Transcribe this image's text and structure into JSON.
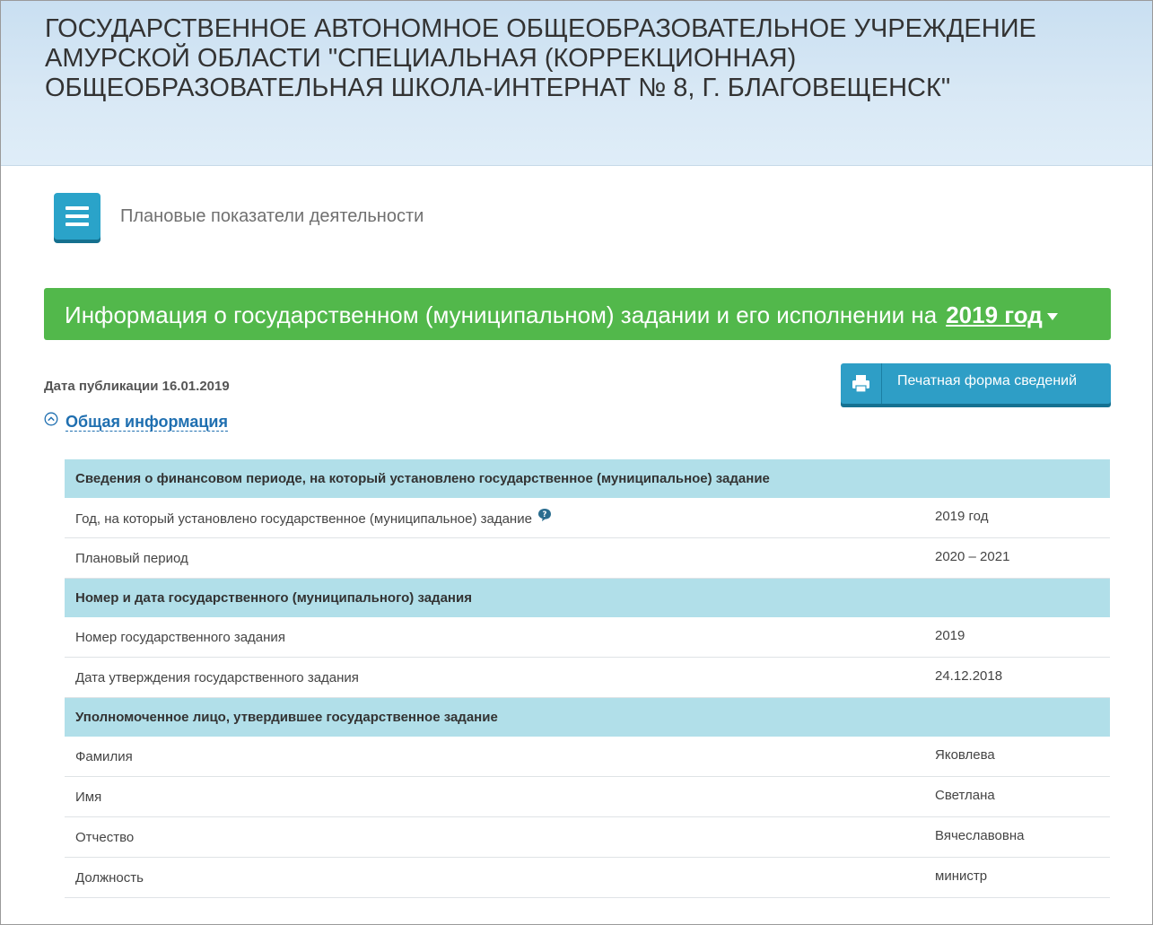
{
  "header": {
    "org_title": "ГОСУДАРСТВЕННОЕ АВТОНОМНОЕ ОБЩЕОБРАЗОВАТЕЛЬНОЕ УЧРЕЖДЕНИЕ АМУРСКОЙ ОБЛАСТИ \"СПЕЦИАЛЬНАЯ (КОРРЕКЦИОННАЯ) ОБЩЕОБРАЗОВАТЕЛЬНАЯ ШКОЛА-ИНТЕРНАТ № 8, Г. БЛАГОВЕЩЕНСК\""
  },
  "nav": {
    "menu_icon": "hamburger-icon",
    "section_name": "Плановые показатели деятельности"
  },
  "banner": {
    "text": "Информация о государственном (муниципальном) задании и его исполнении на",
    "year": "2019 год",
    "year_icon": "caret-down-icon",
    "color": "#52b84b"
  },
  "publication": {
    "date_text": "Дата публикации 16.01.2019"
  },
  "print_button": {
    "label": "Печатная форма сведений",
    "icon": "printer-icon",
    "color": "#2e9ec6"
  },
  "general_toggle": {
    "label": "Общая информация",
    "icon": "chevron-up-circle-icon"
  },
  "sections": [
    {
      "title": "Сведения о финансовом периоде, на который установлено государственное (муниципальное) задание",
      "rows": [
        {
          "label": "Год, на который установлено государственное (муниципальное) задание",
          "value": "2019 год",
          "help_icon": "help-icon"
        },
        {
          "label": "Плановый период",
          "value": "2020 – 2021"
        }
      ]
    },
    {
      "title": "Номер и дата государственного (муниципального) задания",
      "rows": [
        {
          "label": "Номер государственного задания",
          "value": "2019"
        },
        {
          "label": "Дата утверждения государственного задания",
          "value": "24.12.2018"
        }
      ]
    },
    {
      "title": "Уполномоченное лицо, утвердившее государственное задание",
      "rows": [
        {
          "label": "Фамилия",
          "value": "Яковлева"
        },
        {
          "label": "Имя",
          "value": "Светлана"
        },
        {
          "label": "Отчество",
          "value": "Вячеславовна"
        },
        {
          "label": "Должность",
          "value": "министр"
        }
      ]
    }
  ],
  "colors": {
    "section_header_bg": "#b1dfe9",
    "link": "#1f6fb0"
  }
}
